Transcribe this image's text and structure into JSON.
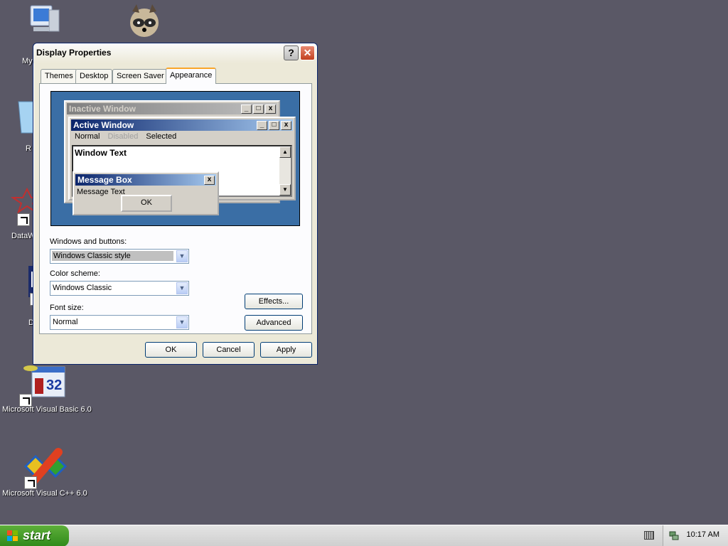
{
  "desktop": {
    "icons": [
      {
        "label": "My"
      },
      {
        "label": "R"
      },
      {
        "label": "DataW"
      },
      {
        "label": "D"
      },
      {
        "label": "Microsoft Visual Basic 6.0"
      },
      {
        "label": "Microsoft Visual C++ 6.0"
      }
    ]
  },
  "dialog": {
    "title": "Display Properties",
    "help_glyph": "?",
    "close_glyph": "✕",
    "tabs": [
      {
        "label": "Themes"
      },
      {
        "label": "Desktop"
      },
      {
        "label": "Screen Saver"
      },
      {
        "label": "Appearance",
        "active": true
      }
    ],
    "preview": {
      "inactive_title": "Inactive Window",
      "active_title": "Active Window",
      "menu": {
        "normal": "Normal",
        "disabled": "Disabled",
        "selected": "Selected"
      },
      "window_text": "Window Text",
      "message_box_title": "Message Box",
      "message_text": "Message Text",
      "ok_label": "OK"
    },
    "fields": {
      "windows_buttons_label": "Windows and buttons:",
      "windows_buttons_value": "Windows Classic style",
      "color_scheme_label": "Color scheme:",
      "color_scheme_value": "Windows Classic",
      "font_size_label": "Font size:",
      "font_size_value": "Normal"
    },
    "buttons": {
      "effects": "Effects...",
      "advanced": "Advanced",
      "ok": "OK",
      "cancel": "Cancel",
      "apply": "Apply"
    }
  },
  "taskbar": {
    "start_label": "start",
    "clock": "10:17 AM"
  },
  "colors": {
    "desktop": "#5a5866",
    "preview_bg": "#3a6ea5",
    "active_title": "#0a246a"
  }
}
